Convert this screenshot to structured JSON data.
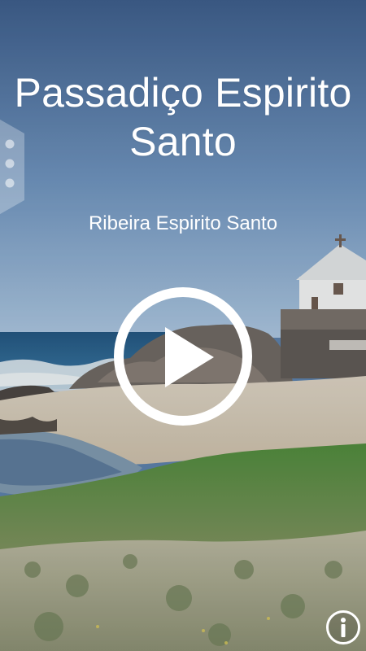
{
  "location": {
    "title": "Passadiço Espirito Santo",
    "subtitle": "Ribeira Espirito Santo"
  },
  "controls": {
    "play_icon": "play-circle-icon",
    "info_icon": "info-circle-icon",
    "menu_icon": "side-menu-dots-icon"
  },
  "colors": {
    "overlay_text": "#ffffff",
    "sky_top": "#3f5f8c",
    "sky_bottom": "#8fb0cf",
    "sea": "#2f6e9d",
    "sand": "#d9cfbf",
    "grass": "#5c8a45"
  }
}
